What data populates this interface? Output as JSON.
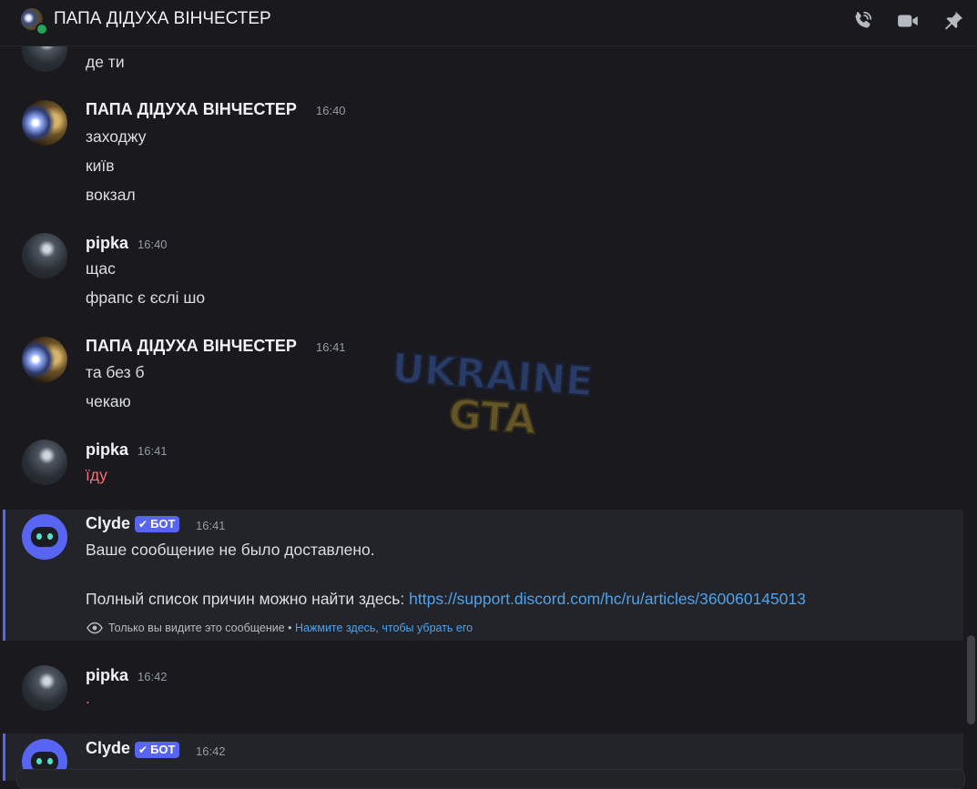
{
  "header": {
    "title": "ПАПА ДІДУХА ВІНЧЕСТЕР",
    "icons": [
      "phone-call-icon",
      "video-camera-icon",
      "pin-icon"
    ]
  },
  "colors": {
    "background": "#1a1a1e",
    "accent": "#5865f2",
    "link": "#4aa3f0",
    "online": "#23a55a",
    "error_text": "#f07178"
  },
  "messages": {
    "top_line": "де ти",
    "g1": {
      "author": "ПАПА  ДІДУХА ВІНЧЕСТЕР",
      "time": "16:40",
      "lines": [
        "заходжу",
        "київ",
        "вокзал"
      ]
    },
    "g2": {
      "author": "pipka",
      "time": "16:40",
      "lines": [
        "щас",
        "фрапс є єслі шо"
      ]
    },
    "g3": {
      "author": "ПАПА  ДІДУХА ВІНЧЕСТЕР",
      "time": "16:41",
      "lines": [
        "та без б",
        "чекаю"
      ]
    },
    "g4": {
      "author": "pipka",
      "time": "16:41",
      "lines": [
        "їду"
      ]
    },
    "g5": {
      "author": "Clyde",
      "badge": "БОТ",
      "time": "16:41",
      "line1": "Ваше сообщение не было доставлено.",
      "line2_prefix": "Полный список причин можно найти здесь: ",
      "link": "https://support.discord.com/hc/ru/articles/360060145013",
      "ephemeral_note": "Только вы видите это сообщение",
      "separator": " • ",
      "dismiss": "Нажмите здесь, чтобы убрать его"
    },
    "g6": {
      "author": "pipka",
      "time": "16:42",
      "lines": [
        "."
      ]
    },
    "g7": {
      "author": "Clyde",
      "badge": "БОТ",
      "time": "16:42"
    }
  },
  "watermark": {
    "line1": "UKRAINE",
    "line2": "GTA"
  }
}
